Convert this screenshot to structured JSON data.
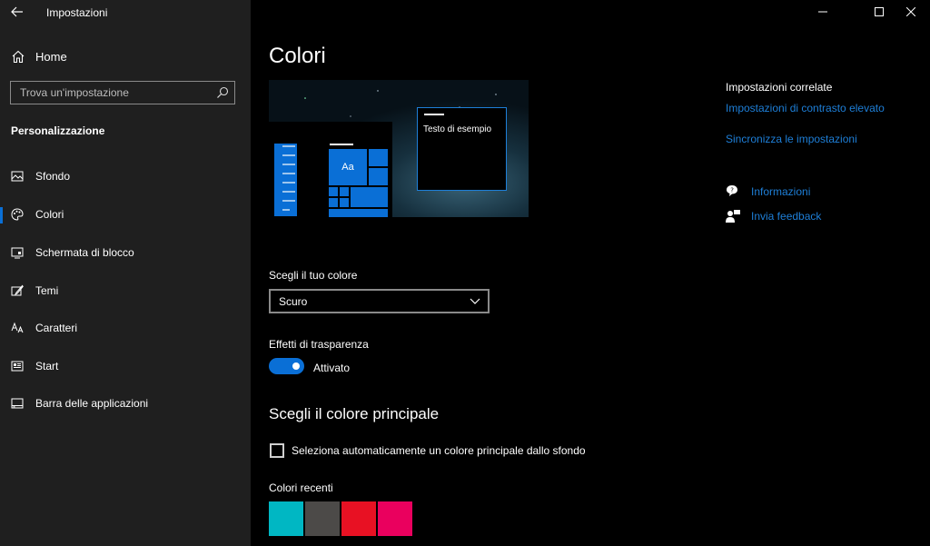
{
  "window": {
    "app_title": "Impostazioni"
  },
  "sidebar": {
    "home_label": "Home",
    "search_placeholder": "Trova un'impostazione",
    "section_title": "Personalizzazione",
    "items": [
      {
        "label": "Sfondo",
        "icon": "picture-icon"
      },
      {
        "label": "Colori",
        "icon": "palette-icon",
        "active": true
      },
      {
        "label": "Schermata di blocco",
        "icon": "lock-screen-icon"
      },
      {
        "label": "Temi",
        "icon": "brush-icon"
      },
      {
        "label": "Caratteri",
        "icon": "font-icon"
      },
      {
        "label": "Start",
        "icon": "start-icon"
      },
      {
        "label": "Barra delle applicazioni",
        "icon": "taskbar-icon"
      }
    ]
  },
  "main": {
    "title": "Colori",
    "preview": {
      "tile_text": "Aa",
      "sample_window_text": "Testo di esempio"
    },
    "choose_color_label": "Scegli il tuo colore",
    "choose_color_value": "Scuro",
    "transparency_label": "Effetti di trasparenza",
    "transparency_state": "Attivato",
    "accent_heading": "Scegli il colore principale",
    "auto_accent_label": "Seleziona automaticamente un colore principale dallo sfondo",
    "recent_colors_label": "Colori recenti",
    "recent_colors": [
      "#00b7c3",
      "#4c4a48",
      "#e81123",
      "#ea005e"
    ]
  },
  "related": {
    "heading": "Impostazioni correlate",
    "links": [
      "Impostazioni di contrasto elevato",
      "Sincronizza le impostazioni"
    ],
    "help_links": [
      {
        "label": "Informazioni",
        "icon": "help-chat-icon"
      },
      {
        "label": "Invia feedback",
        "icon": "feedback-icon"
      }
    ]
  },
  "colors": {
    "accent": "#0a6fd6",
    "link": "#1e7fd8",
    "sidebar_bg": "#1f1f1f",
    "main_bg": "#000000"
  }
}
